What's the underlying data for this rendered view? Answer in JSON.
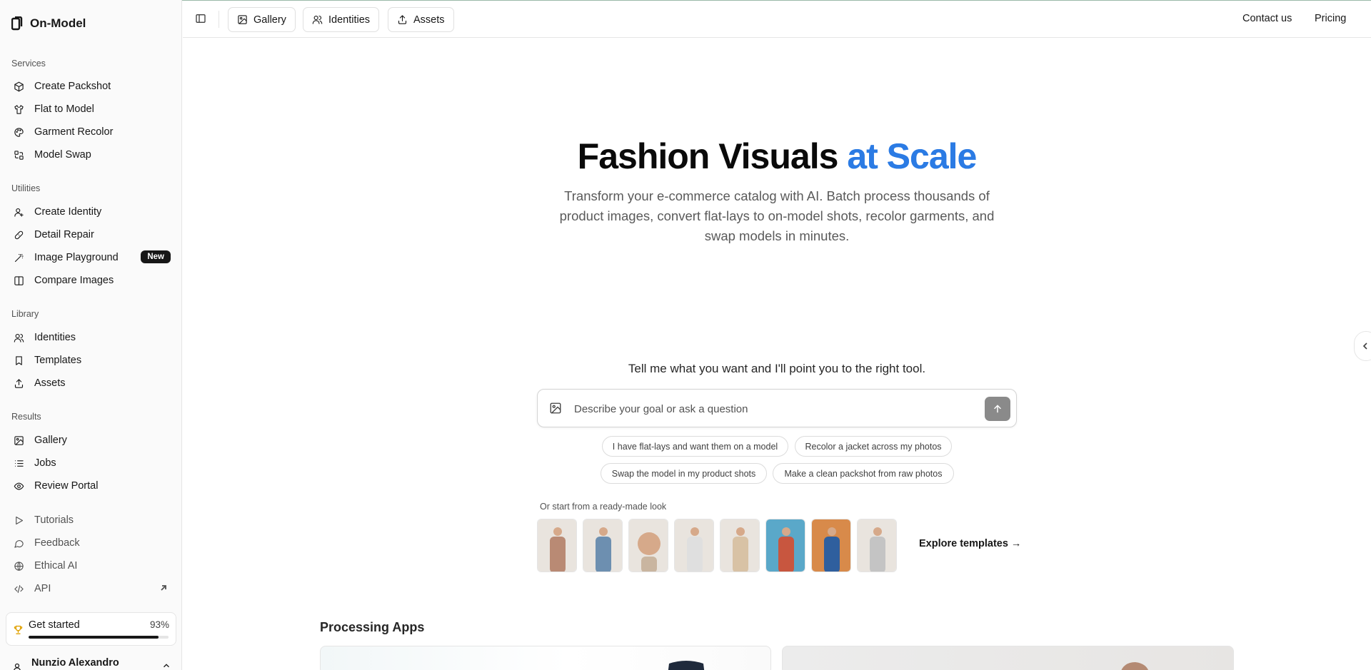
{
  "app": {
    "name": "On-Model"
  },
  "sidebar": {
    "sections": [
      {
        "label": "Services",
        "items": [
          {
            "label": "Create Packshot",
            "icon": "cube-icon"
          },
          {
            "label": "Flat to Model",
            "icon": "shirt-icon"
          },
          {
            "label": "Garment Recolor",
            "icon": "palette-icon"
          },
          {
            "label": "Model Swap",
            "icon": "swap-icon"
          }
        ]
      },
      {
        "label": "Utilities",
        "items": [
          {
            "label": "Create Identity",
            "icon": "user-plus-icon"
          },
          {
            "label": "Detail Repair",
            "icon": "bandage-icon"
          },
          {
            "label": "Image Playground",
            "icon": "wand-icon",
            "badge": "New"
          },
          {
            "label": "Compare Images",
            "icon": "columns-icon"
          }
        ]
      },
      {
        "label": "Library",
        "items": [
          {
            "label": "Identities",
            "icon": "users-icon"
          },
          {
            "label": "Templates",
            "icon": "bookmark-icon"
          },
          {
            "label": "Assets",
            "icon": "upload-icon"
          }
        ]
      },
      {
        "label": "Results",
        "items": [
          {
            "label": "Gallery",
            "icon": "image-icon"
          },
          {
            "label": "Jobs",
            "icon": "list-icon"
          },
          {
            "label": "Review Portal",
            "icon": "eye-icon"
          }
        ]
      }
    ],
    "footer_links": [
      {
        "label": "Tutorials",
        "icon": "play-icon"
      },
      {
        "label": "Feedback",
        "icon": "message-icon"
      },
      {
        "label": "Ethical AI",
        "icon": "globe-icon"
      },
      {
        "label": "API",
        "icon": "code-icon"
      }
    ],
    "get_started": {
      "label": "Get started",
      "percent_label": "93%",
      "progress": 0.93
    },
    "user": {
      "name": "Nunzio Alexandro"
    }
  },
  "topbar": {
    "buttons": [
      "Gallery",
      "Identities",
      "Assets"
    ],
    "links": [
      "Contact us",
      "Pricing"
    ]
  },
  "hero": {
    "title_main": "Fashion Visuals",
    "title_accent": "at Scale",
    "subtitle": "Transform your e-commerce catalog with AI. Batch process thousands of product images, convert flat-lays to on-model shots, recolor garments, and swap models in minutes."
  },
  "assistant": {
    "prompt": "Tell me what you want and I'll point you to the right tool.",
    "placeholder": "Describe your goal or ask a question",
    "suggestions": [
      "I have flat-lays and want them on a model",
      "Recolor a jacket across my photos",
      "Swap the model in my product shots",
      "Make a clean packshot from raw photos"
    ]
  },
  "looks": {
    "label": "Or start from a ready-made look",
    "explore_label": "Explore templates →",
    "thumbnail_colors": [
      "#b98a74",
      "#6d8fb0",
      "#c9b5a0",
      "#dfdfdf",
      "#d8c2a5",
      "#c8563f",
      "#2f5f9e",
      "#c4c4c4"
    ]
  },
  "processing": {
    "title": "Processing Apps"
  },
  "colors": {
    "accent": "#2b7be4",
    "brand_dark": "#171717",
    "badge_bg": "#171717"
  }
}
